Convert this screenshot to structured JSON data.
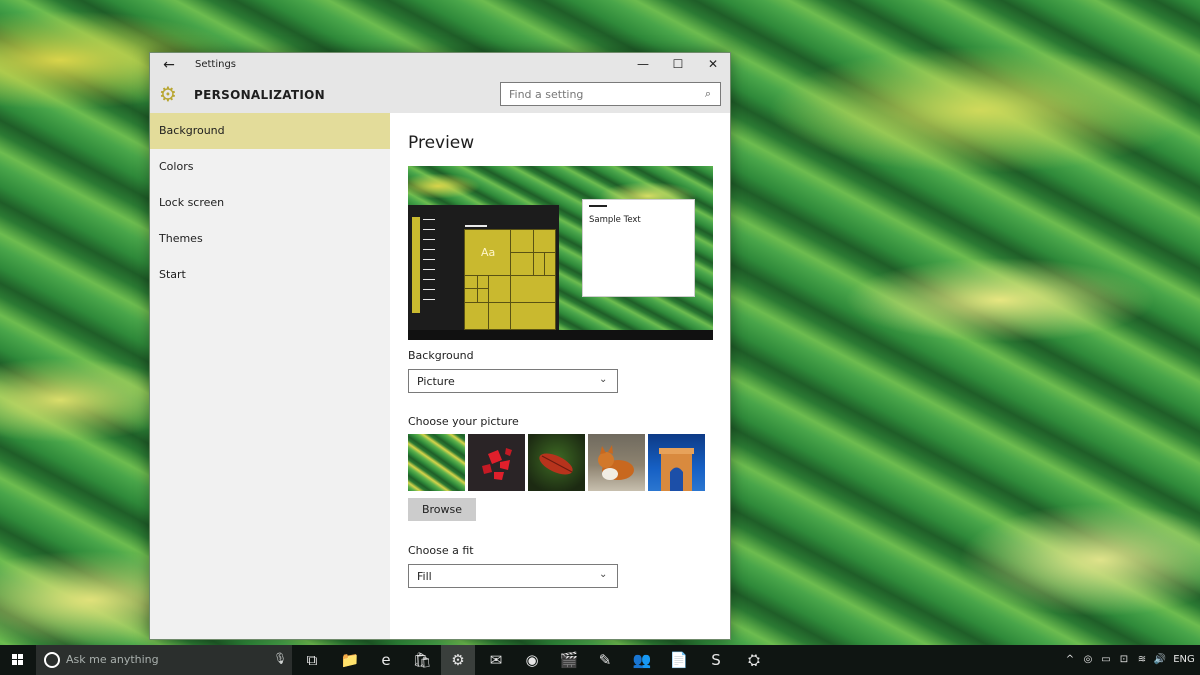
{
  "window": {
    "title": "Settings",
    "back_glyph": "←",
    "minimize_glyph": "—",
    "maximize_glyph": "☐",
    "close_glyph": "✕",
    "section_title": "PERSONALIZATION",
    "gear_glyph": "⚙"
  },
  "search": {
    "placeholder": "Find a setting",
    "icon_glyph": "⌕"
  },
  "nav": {
    "items": [
      {
        "label": "Background",
        "active": true
      },
      {
        "label": "Colors",
        "active": false
      },
      {
        "label": "Lock screen",
        "active": false
      },
      {
        "label": "Themes",
        "active": false
      },
      {
        "label": "Start",
        "active": false
      }
    ]
  },
  "main": {
    "preview_heading": "Preview",
    "preview_tile_text": "Aa",
    "preview_sample_text": "Sample Text",
    "background_label": "Background",
    "background_value": "Picture",
    "choose_picture_label": "Choose your picture",
    "browse_label": "Browse",
    "choose_fit_label": "Choose a fit",
    "fit_value": "Fill",
    "chevron_glyph": "⌄"
  },
  "taskbar": {
    "search_placeholder": "Ask me anything",
    "mic_glyph": "🎙",
    "apps": [
      {
        "name": "task-view-icon",
        "glyph": "⧉",
        "active": false
      },
      {
        "name": "file-explorer-icon",
        "glyph": "📁",
        "active": false
      },
      {
        "name": "edge-icon",
        "glyph": "e",
        "active": false
      },
      {
        "name": "store-icon",
        "glyph": "🛍",
        "active": false
      },
      {
        "name": "settings-icon",
        "glyph": "⚙",
        "active": true
      },
      {
        "name": "mail-icon",
        "glyph": "✉",
        "active": false
      },
      {
        "name": "webcam-icon",
        "glyph": "◉",
        "active": false
      },
      {
        "name": "movies-icon",
        "glyph": "🎬",
        "active": false
      },
      {
        "name": "paint-icon",
        "glyph": "✎",
        "active": false
      },
      {
        "name": "people-icon",
        "glyph": "👥",
        "active": false
      },
      {
        "name": "documents-icon",
        "glyph": "📄",
        "active": false
      },
      {
        "name": "skype-icon",
        "glyph": "S",
        "active": false
      },
      {
        "name": "network-tool-icon",
        "glyph": "⛭",
        "active": false
      }
    ],
    "tray": {
      "chevron_glyph": "^",
      "icons": [
        "◎",
        "▭",
        "⊡",
        "≋",
        "🔊",
        "☐"
      ],
      "language": "ENG"
    }
  },
  "colors": {
    "accent": "#c9b92f",
    "nav_active": "#e3dc9a"
  }
}
